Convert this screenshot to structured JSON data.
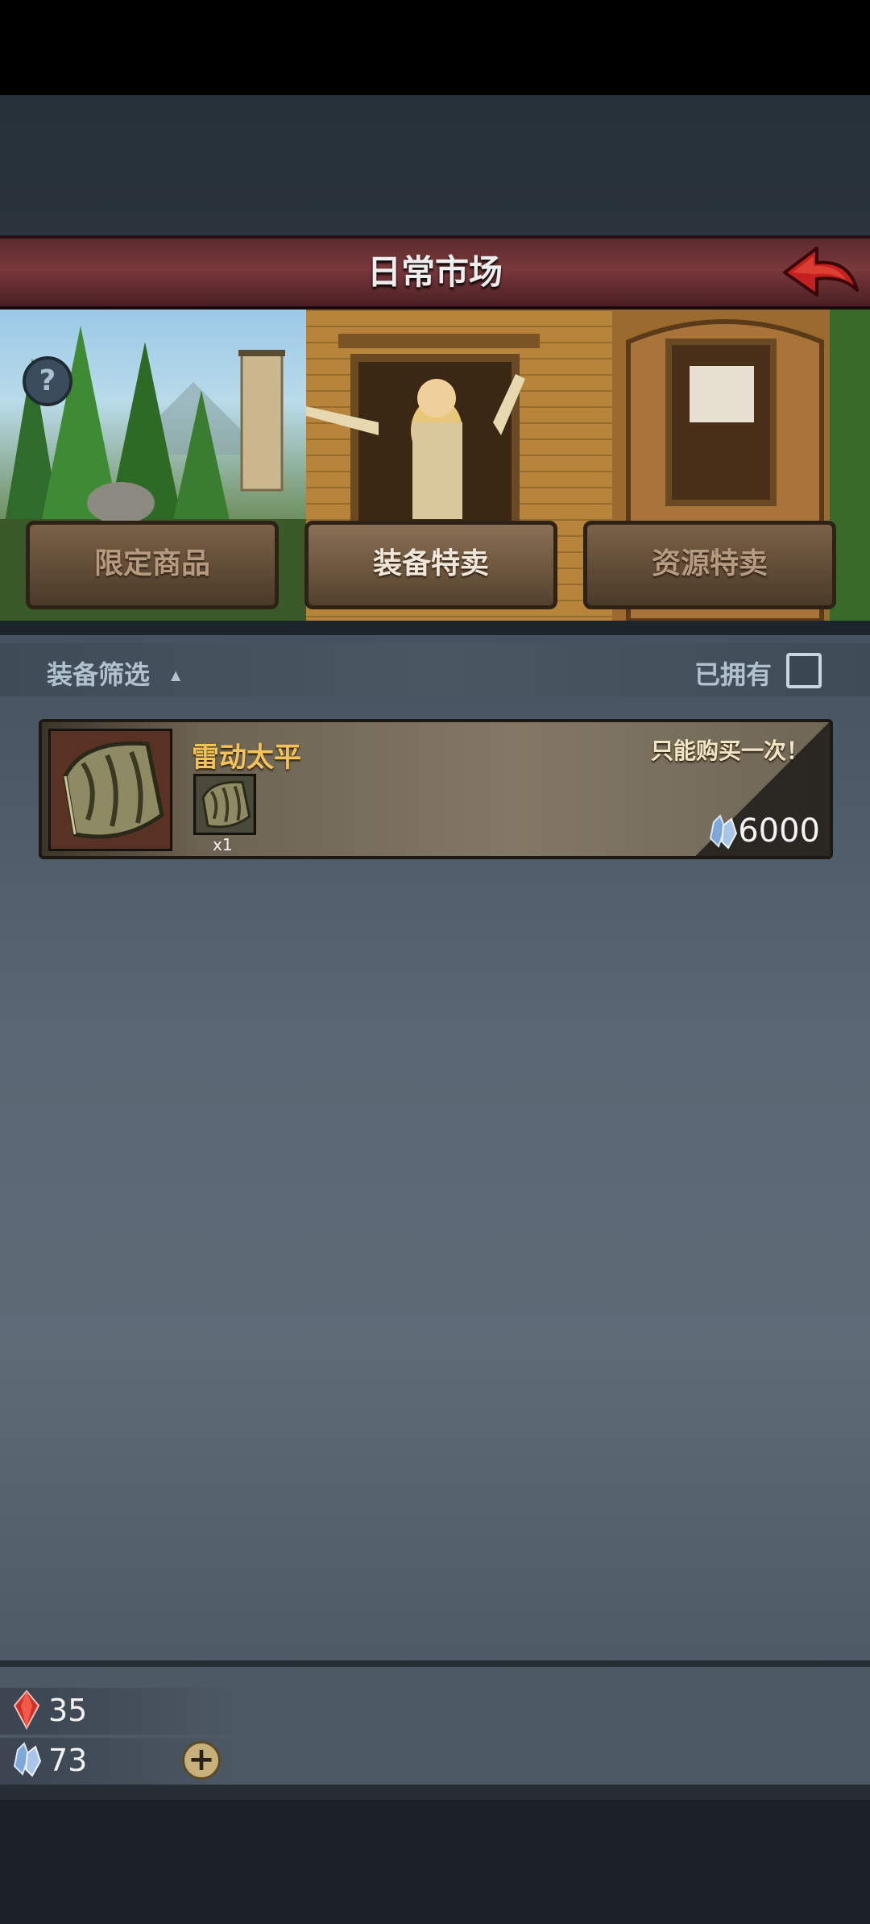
{
  "header": {
    "title": "日常市场"
  },
  "tabs": [
    {
      "label": "限定商品",
      "active": false
    },
    {
      "label": "装备特卖",
      "active": true
    },
    {
      "label": "资源特卖",
      "active": false
    }
  ],
  "filter": {
    "label": "装备筛选",
    "owned_label": "已拥有",
    "owned_checked": false
  },
  "items": [
    {
      "name": "雷动太平",
      "limit": "只能购买一次！",
      "quantity": "x1",
      "price": "6000",
      "currency_icon": "crystal-icon"
    }
  ],
  "resources": [
    {
      "icon": "ruby-icon",
      "value": "35"
    },
    {
      "icon": "crystal-icon",
      "value": "73"
    }
  ],
  "colors": {
    "header_red": "#7a383c",
    "item_name_gold": "#f3c35a",
    "panel_gray": "#5a6774",
    "tab_brown": "#5e4a35"
  }
}
